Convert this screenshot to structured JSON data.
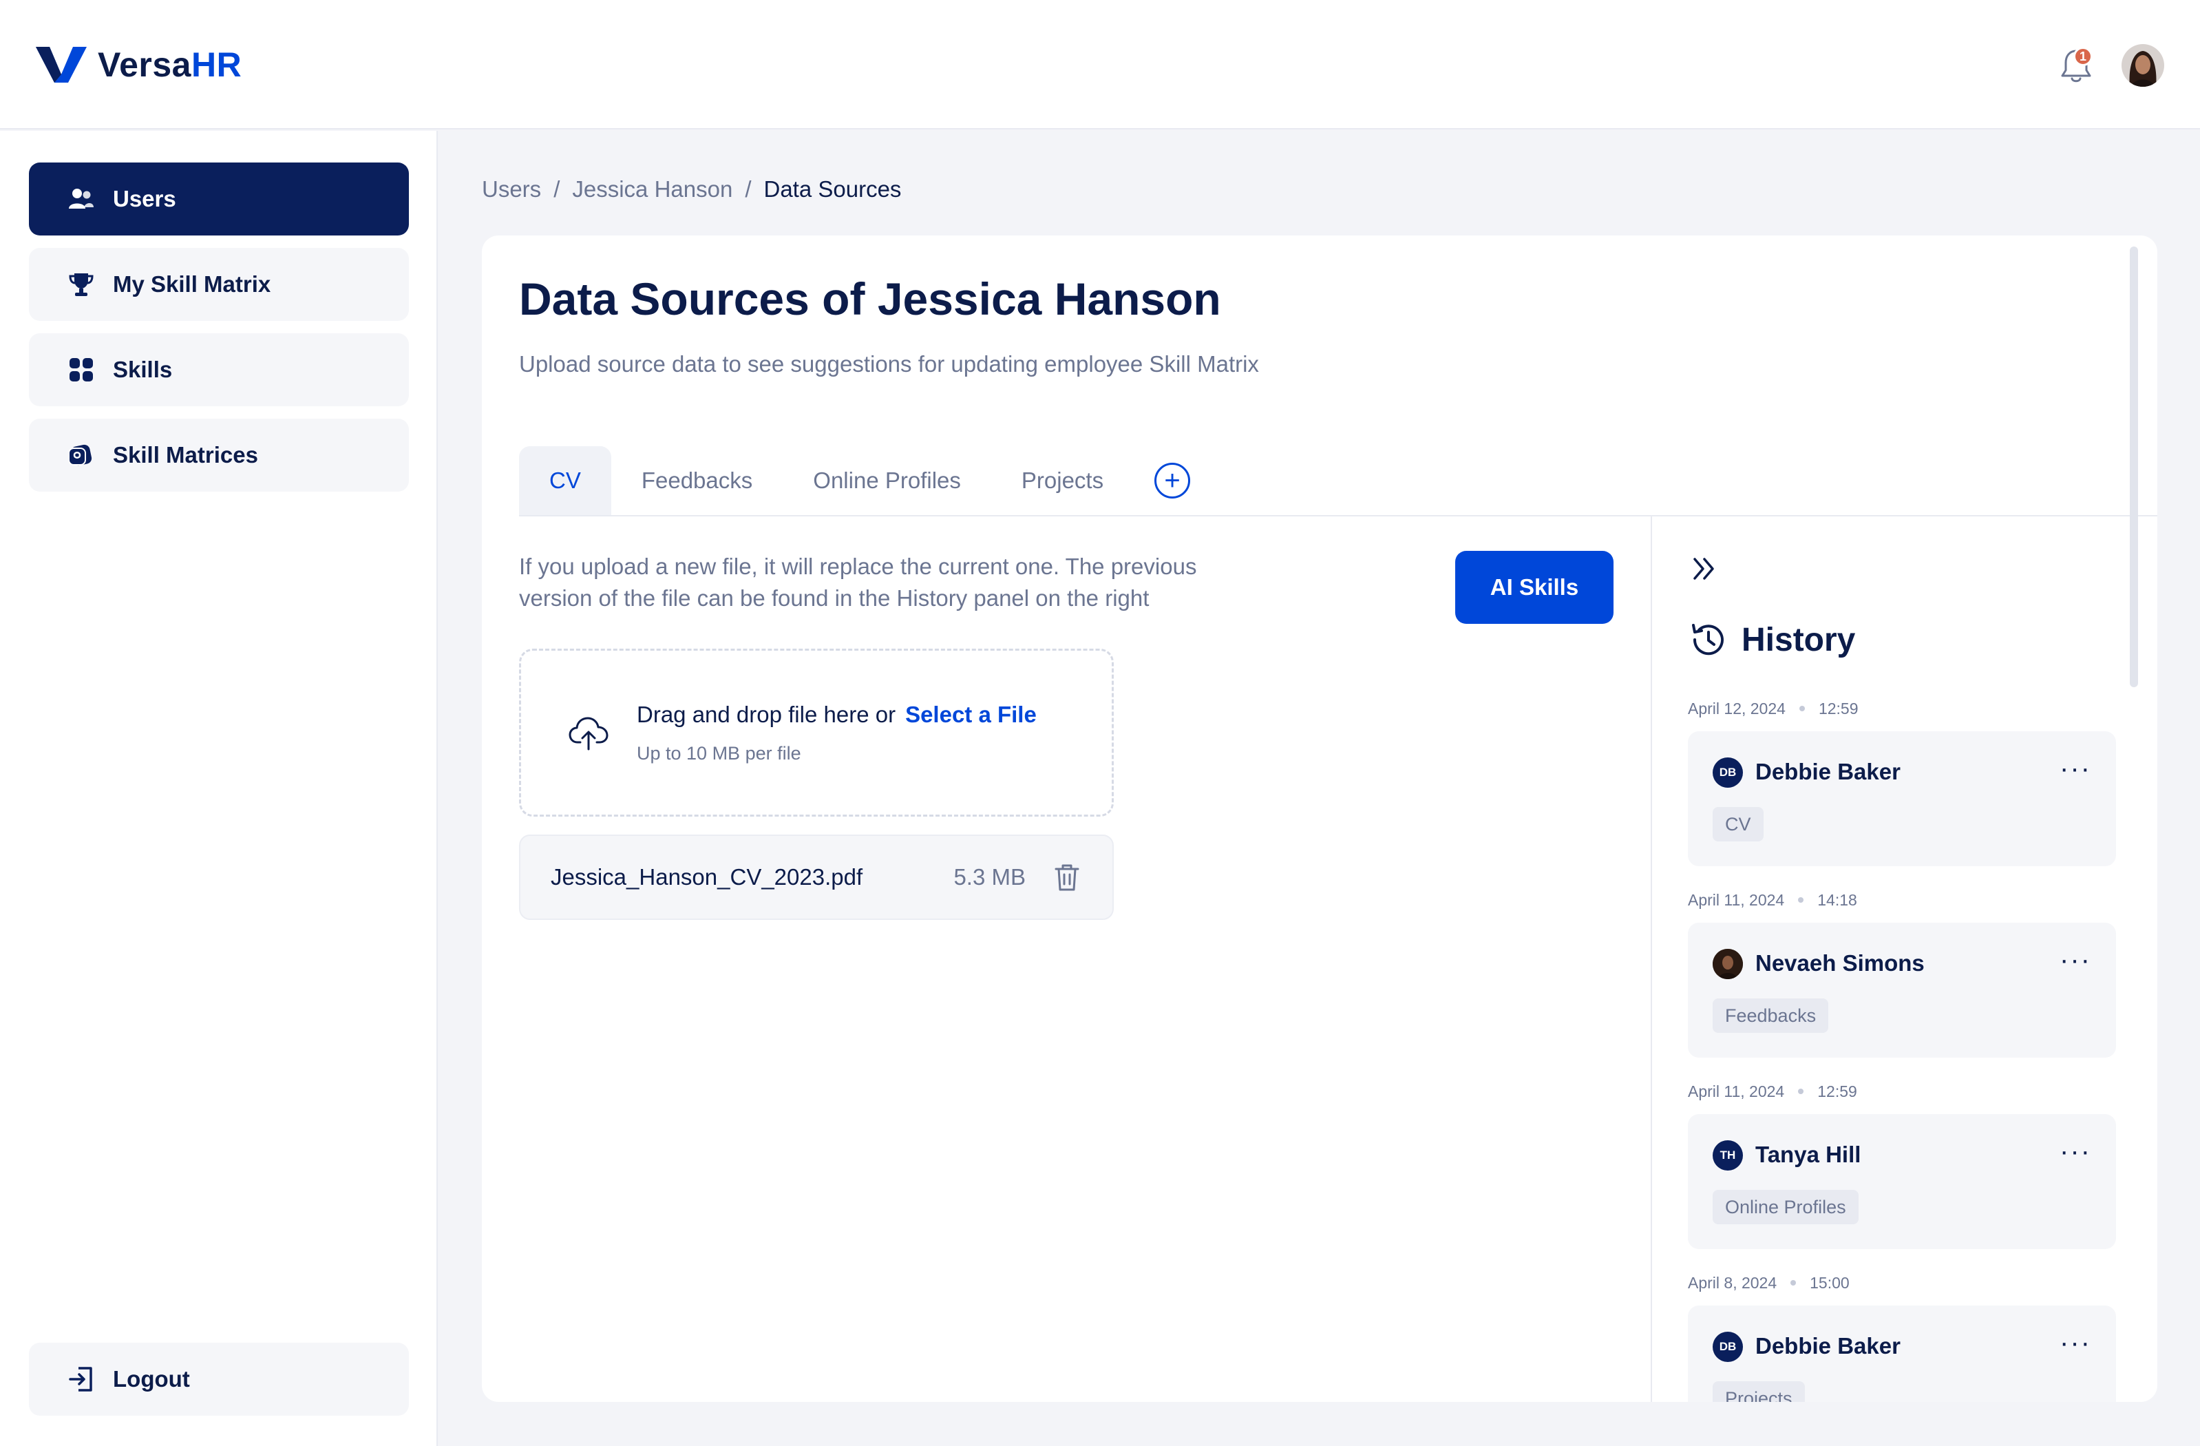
{
  "app": {
    "name_prefix": "Versa",
    "name_suffix": "HR"
  },
  "header": {
    "notification_count": "1"
  },
  "sidebar": {
    "items": [
      {
        "label": "Users",
        "icon": "users-icon"
      },
      {
        "label": "My Skill Matrix",
        "icon": "trophy-icon"
      },
      {
        "label": "Skills",
        "icon": "grid-icon"
      },
      {
        "label": "Skill Matrices",
        "icon": "matrix-icon"
      }
    ],
    "logout_label": "Logout"
  },
  "breadcrumb": {
    "items": [
      "Users",
      "Jessica Hanson",
      "Data Sources"
    ],
    "separator": "/"
  },
  "page": {
    "title": "Data Sources of Jessica Hanson",
    "subtitle": "Upload source data to see suggestions for updating employee Skill Matrix"
  },
  "tabs": [
    {
      "label": "CV",
      "active": true
    },
    {
      "label": "Feedbacks",
      "active": false
    },
    {
      "label": "Online Profiles",
      "active": false
    },
    {
      "label": "Projects",
      "active": false
    }
  ],
  "tab_add_label": "+",
  "cv": {
    "info_line1": "If you upload a new file, it will replace the current one. The previous",
    "info_line2": "version of the file can be found in the History panel on the right",
    "ai_button_label": "AI Skills",
    "dropzone_text": "Drag and drop file here or",
    "dropzone_link": "Select a File",
    "dropzone_hint": "Up to 10 MB per file",
    "file": {
      "name": "Jessica_Hanson_CV_2023.pdf",
      "size": "5.3 MB"
    }
  },
  "history": {
    "title": "History",
    "more_label": "···",
    "entries": [
      {
        "date": "April 12, 2024",
        "time": "12:59",
        "initials": "DB",
        "name": "Debbie Baker",
        "tag": "CV",
        "photo": false
      },
      {
        "date": "April 11, 2024",
        "time": "14:18",
        "initials": "",
        "name": "Nevaeh Simons",
        "tag": "Feedbacks",
        "photo": true
      },
      {
        "date": "April 11, 2024",
        "time": "12:59",
        "initials": "TH",
        "name": "Tanya Hill",
        "tag": "Online Profiles",
        "photo": false
      },
      {
        "date": "April 8, 2024",
        "time": "15:00",
        "initials": "DB",
        "name": "Debbie Baker",
        "tag": "Projects",
        "photo": false
      }
    ]
  },
  "colors": {
    "primary": "#0047d9",
    "navy": "#0a1f5c",
    "muted": "#6b7591",
    "badge": "#d9664a"
  }
}
